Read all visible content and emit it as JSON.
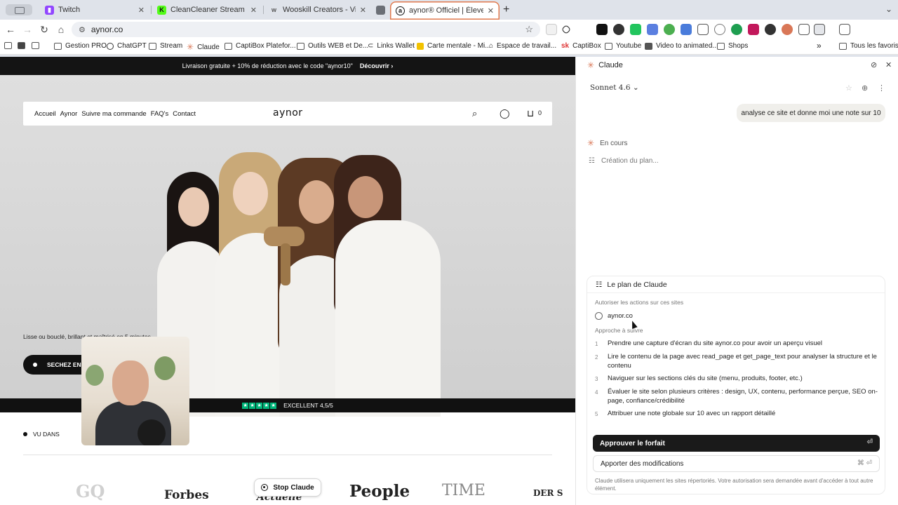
{
  "browser": {
    "tabs": [
      {
        "title": "",
        "favicon_color": "#c9cdd4"
      },
      {
        "title": "Twitch",
        "favicon_color": "#9146ff"
      },
      {
        "title": "CleanCleaner Stream - Watch",
        "favicon_color": "#53fc18"
      },
      {
        "title": "Wooskill Creators - Vivez de",
        "favicon_color": "#555555"
      },
      {
        "title": "",
        "favicon_color": "#6b6f76"
      },
      {
        "title": "aynor® Officiel | Élevez votre",
        "favicon_color": "#111111"
      }
    ],
    "active_tab_index": 5,
    "accent_color": "#e07a4f",
    "url": "aynor.co",
    "bookmarks": [
      {
        "label": "",
        "icon": "reading-list-icon"
      },
      {
        "label": "",
        "icon": "apps-icon"
      },
      {
        "label": "Gestion PRO",
        "icon": "folder-icon"
      },
      {
        "label": "ChatGPT",
        "icon": "chatgpt-icon"
      },
      {
        "label": "Stream",
        "icon": "folder-icon"
      },
      {
        "label": "Claude",
        "icon": "claude-icon"
      },
      {
        "label": "CaptiBox Platefor...",
        "icon": "folder-icon"
      },
      {
        "label": "Outils WEB et De...",
        "icon": "folder-icon"
      },
      {
        "label": "Links Wallet",
        "icon": "link-icon"
      },
      {
        "label": "Carte mentale - Mi...",
        "icon": "mindmap-icon"
      },
      {
        "label": "Espace de travail...",
        "icon": "home-icon"
      },
      {
        "label": "CaptiBox",
        "icon": "captibox-icon"
      },
      {
        "label": "Youtube",
        "icon": "folder-icon"
      },
      {
        "label": "Video to animated...",
        "icon": "video-icon"
      },
      {
        "label": "Shops",
        "icon": "folder-icon"
      }
    ],
    "more_bookmarks": "»",
    "all_bookmarks": "Tous les favoris"
  },
  "site": {
    "promo_text": "Livraison gratuite + 10% de réduction avec le code \"aynor10\"",
    "promo_link": "Découvrir",
    "nav": [
      "Accueil",
      "Aynor",
      "Suivre ma commande",
      "FAQ's",
      "Contact"
    ],
    "logo": "aynor",
    "cart_count": "0",
    "tagline": "Lisse ou bouclé, brillant et maîtrisé en 5 minutes",
    "cta": "SECHEZ EN 5",
    "trust_text": "EXCELLENT 4,5/5",
    "trust_rating": 4.5,
    "seen_in": "VU DANS",
    "press": [
      "GQ",
      "Forbes",
      "Actuelle",
      "People",
      "TIME",
      "DER S"
    ]
  },
  "overlay": {
    "stop_label": "Stop Claude"
  },
  "panel": {
    "title": "Claude",
    "model": "Sonnet 4.6",
    "user_message": "analyse ce site et donne moi une note sur 10",
    "status": "En cours",
    "creating": "Création du plan...",
    "plan_title": "Le plan de Claude",
    "allow_label": "Autoriser les actions sur ces sites",
    "site": "aynor.co",
    "approach_label": "Approche à suivre",
    "steps": [
      "Prendre une capture d'écran du site aynor.co pour avoir un aperçu visuel",
      "Lire le contenu de la page avec read_page et get_page_text pour analyser la structure et le contenu",
      "Naviguer sur les sections clés du site (menu, produits, footer, etc.)",
      "Évaluer le site selon plusieurs critères : design, UX, contenu, performance perçue, SEO on-page, confiance/crédibilité",
      "Attribuer une note globale sur 10 avec un rapport détaillé"
    ],
    "approve": "Approuver le forfait",
    "approve_kbd": "⏎",
    "modify": "Apporter des modifications",
    "modify_kbd": "⌘ ⏎",
    "notice": "Claude utilisera uniquement les sites répertoriés. Votre autorisation sera demandée avant d'accéder à tout autre élément.",
    "brand_color": "#d97757"
  }
}
